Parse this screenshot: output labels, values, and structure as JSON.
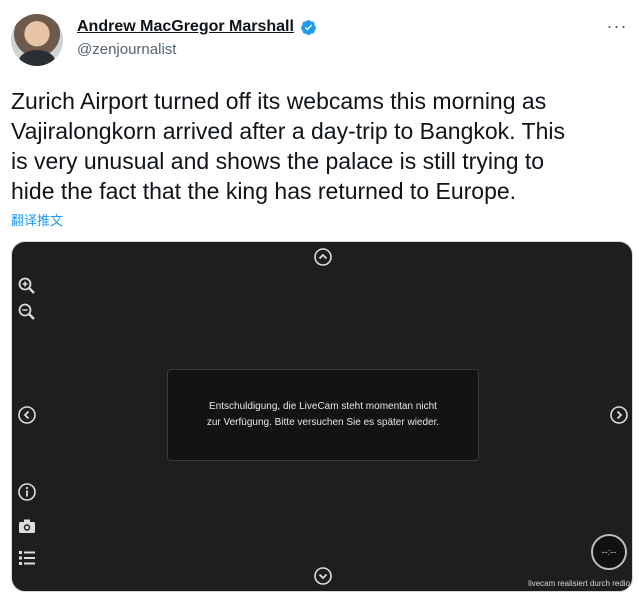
{
  "tweet": {
    "author_name": "Andrew MacGregor Marshall",
    "handle": "@zenjournalist",
    "more_glyph": "···",
    "text": "Zurich Airport turned off its webcams this morning as\nVajiralongkorn arrived after a day-trip to Bangkok. This\nis very unusual and shows the palace is still trying to\nhide the fact that the king has returned to Europe.",
    "translate_label": "翻译推文"
  },
  "webcam": {
    "message_line1": "Entschuldigung, die LiveCam steht momentan nicht",
    "message_line2": "zur Verfügung. Bitte versuchen Sie es später wieder.",
    "timer": "--:--",
    "credit": "livecam realisiert durch redio"
  },
  "icons": {
    "verified": "verified-badge-icon",
    "more": "more-options-icon",
    "zoom_in": "zoom-in-icon",
    "zoom_out": "zoom-out-icon",
    "up": "chevron-up-icon",
    "down": "chevron-down-icon",
    "left": "chevron-left-icon",
    "right": "chevron-right-icon",
    "info": "info-icon",
    "camera": "camera-icon",
    "list": "list-icon"
  },
  "colors": {
    "accent": "#1d9bf0",
    "text": "#0f1419",
    "muted": "#536471",
    "webcam_bg": "#1e1e1e"
  }
}
